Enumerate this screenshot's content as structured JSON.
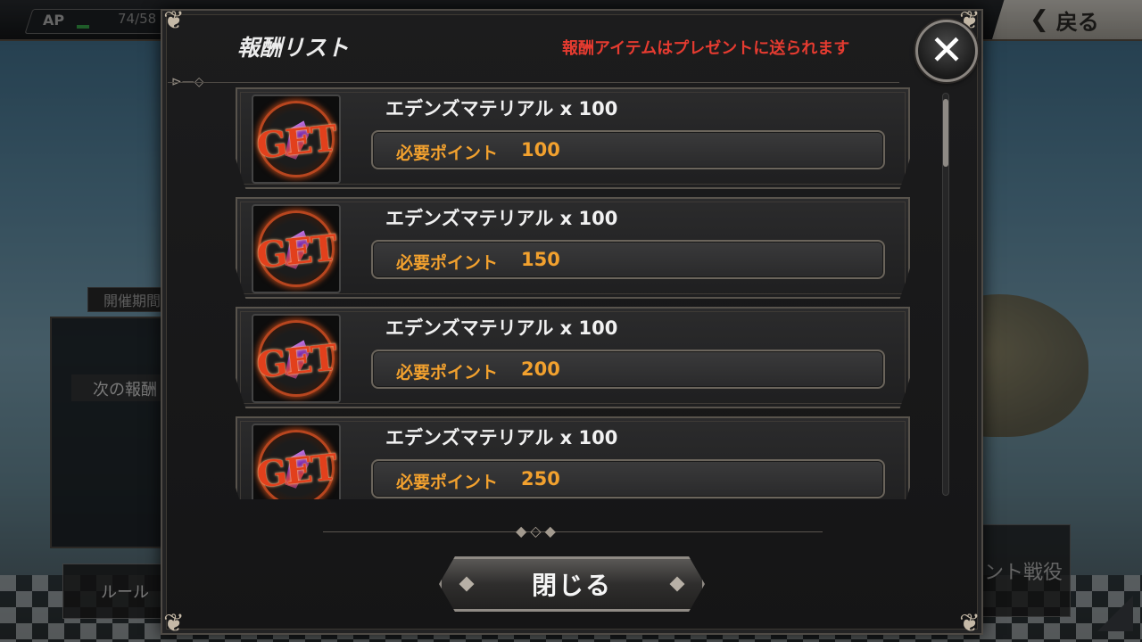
{
  "background": {
    "ap_label": "AP",
    "ap_value": "74/58",
    "back_label": "戻る",
    "side_tab_label": "開催期間",
    "side_text": "次の報酬",
    "rule_button_label": "ルール",
    "event_button_label": "イベント戦役"
  },
  "modal": {
    "title": "報酬リスト",
    "notice": "報酬アイテムはプレゼントに送られます",
    "close_x_symbol": "✕",
    "close_button_label": "閉じる"
  },
  "rewards": [
    {
      "name": "エデンズマテリアル x 100",
      "points_label": "必要ポイント",
      "points": "100",
      "icon_text": "GET"
    },
    {
      "name": "エデンズマテリアル x 100",
      "points_label": "必要ポイント",
      "points": "150",
      "icon_text": "GET"
    },
    {
      "name": "エデンズマテリアル x 100",
      "points_label": "必要ポイント",
      "points": "200",
      "icon_text": "GET"
    },
    {
      "name": "エデンズマテリアル x 100",
      "points_label": "必要ポイント",
      "points": "250",
      "icon_text": "GET"
    }
  ],
  "scroll": {
    "position_fraction": 0.0
  },
  "colors": {
    "notice": "#e53b30",
    "points": "#f2a12e",
    "get_icon": "#e2401c"
  }
}
